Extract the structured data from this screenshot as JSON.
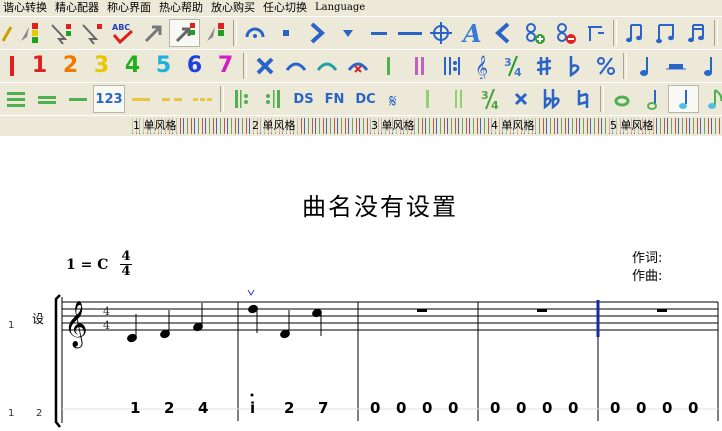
{
  "menu": [
    "谐心转换",
    "精心配器",
    "称心界面",
    "热心帮助",
    "放心购买",
    "任心切换",
    "Language"
  ],
  "toolbar1": {
    "icons": [
      "pencil-icon",
      "level-meter-icon",
      "arrow-meter-icon",
      "arrow-meter-red-icon",
      "spell-check-icon",
      "arrow-select-icon",
      "arrow-select-active-icon",
      "level-meter-alt-icon",
      "fermata-icon",
      "dot-icon",
      "chevron-right-icon",
      "triangle-down-icon",
      "dash-icon",
      "long-dash-icon",
      "crosshair-icon",
      "text-a-icon",
      "chevron-left-icon",
      "add-icon",
      "remove-icon",
      "bar-lines-icon",
      "eighth-notes-icon",
      "flag-icon",
      "beamed-notes-icon",
      "export-icon"
    ]
  },
  "toolbar2": {
    "digits": [
      "1",
      "2",
      "3",
      "4",
      "5",
      "6",
      "7"
    ],
    "digit_colors": [
      "#e02020",
      "#f07a00",
      "#e8c800",
      "#20b020",
      "#20b0e0",
      "#2040e0",
      "#d020c0"
    ]
  },
  "toolbar3": {
    "text_buttons": [
      "123",
      "DS",
      "FN",
      "DC"
    ]
  },
  "tabs": [
    "1 单风格",
    "2 单风格",
    "3 单风格",
    "4 单风格",
    "5 单风格"
  ],
  "score": {
    "title": "曲名没有设置",
    "key": "1 = C",
    "time_top": "4",
    "time_bottom": "4",
    "lyricist": "作词:",
    "composer": "作曲:",
    "instrument": "设",
    "row1_label": "1",
    "row2_label": "1",
    "row2_sub": "2",
    "jianpu": [
      [
        "1",
        "2",
        "4"
      ],
      [
        "i",
        "2",
        "7"
      ],
      [
        "0",
        "0",
        "0",
        "0"
      ],
      [
        "0",
        "0",
        "0",
        "0"
      ],
      [
        "0",
        "0",
        "0",
        "0"
      ]
    ]
  },
  "colors": {
    "chrome": "#ece9d8",
    "barline_selected": "#1a2aa0"
  }
}
